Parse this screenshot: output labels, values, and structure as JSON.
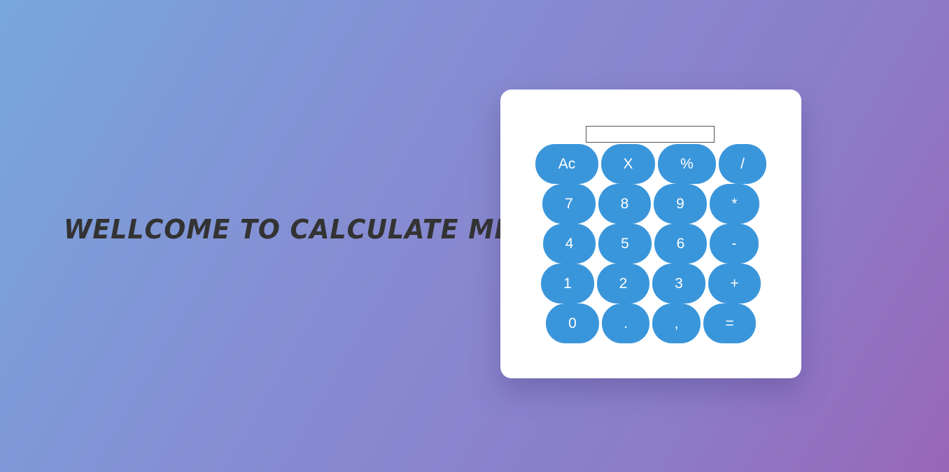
{
  "heading": "WELLCOME TO CALCULATE ME!",
  "display": {
    "value": "",
    "placeholder": ""
  },
  "keys": [
    "Ac",
    "X",
    "%",
    "/",
    "7",
    "8",
    "9",
    "*",
    "4",
    "5",
    "6",
    "-",
    "1",
    "2",
    "3",
    "+",
    "0",
    ".",
    ",",
    "="
  ],
  "colors": {
    "background_start": "#77a7dd",
    "background_end": "#9866ba",
    "panel": "#ffffff",
    "key": "#3a96db",
    "key_text": "#ffffff",
    "heading": "#333333"
  }
}
